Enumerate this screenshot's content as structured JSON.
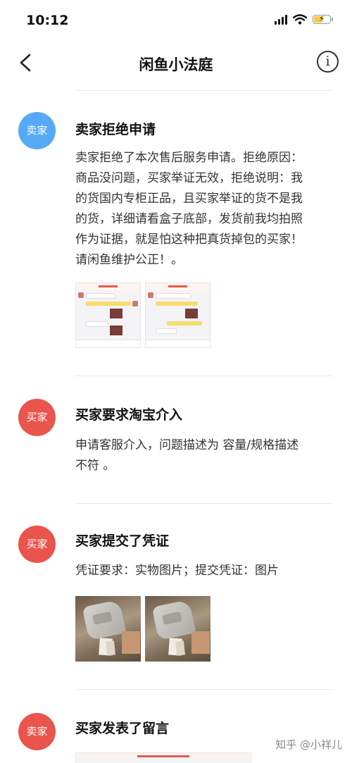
{
  "status_bar": {
    "time": "10:12"
  },
  "nav": {
    "title": "闲鱼小法庭"
  },
  "events": [
    {
      "avatar": "卖家",
      "title": "卖家拒绝申请",
      "text_lines": [
        "卖家拒绝了本次售后服务申请。拒绝原因：",
        "商品没问题，买家举证无效，拒绝说明：我",
        "的货国内专柜正品，且买家举证的货不是我",
        "的货，详细请看盒子底部，发货前我均拍照",
        "作为证据，就是怕这种把真货掉包的买家！",
        "请闲鱼维护公正！。"
      ]
    },
    {
      "avatar": "买家",
      "title": "买家要求淘宝介入",
      "text_lines": [
        "申请客服介入，问题描述为 容量/规格描述",
        "不符 。"
      ]
    },
    {
      "avatar": "买家",
      "title": "买家提交了凭证",
      "text_lines": [
        "凭证要求：实物图片；提交凭证：图片"
      ]
    },
    {
      "avatar": "卖家",
      "title": "买家发表了留言"
    }
  ],
  "watermark": "知乎 @小祥儿",
  "colors": {
    "seller_avatar": "#56a9f5",
    "buyer_avatar": "#e9544d",
    "accent": "#e25b4f"
  }
}
